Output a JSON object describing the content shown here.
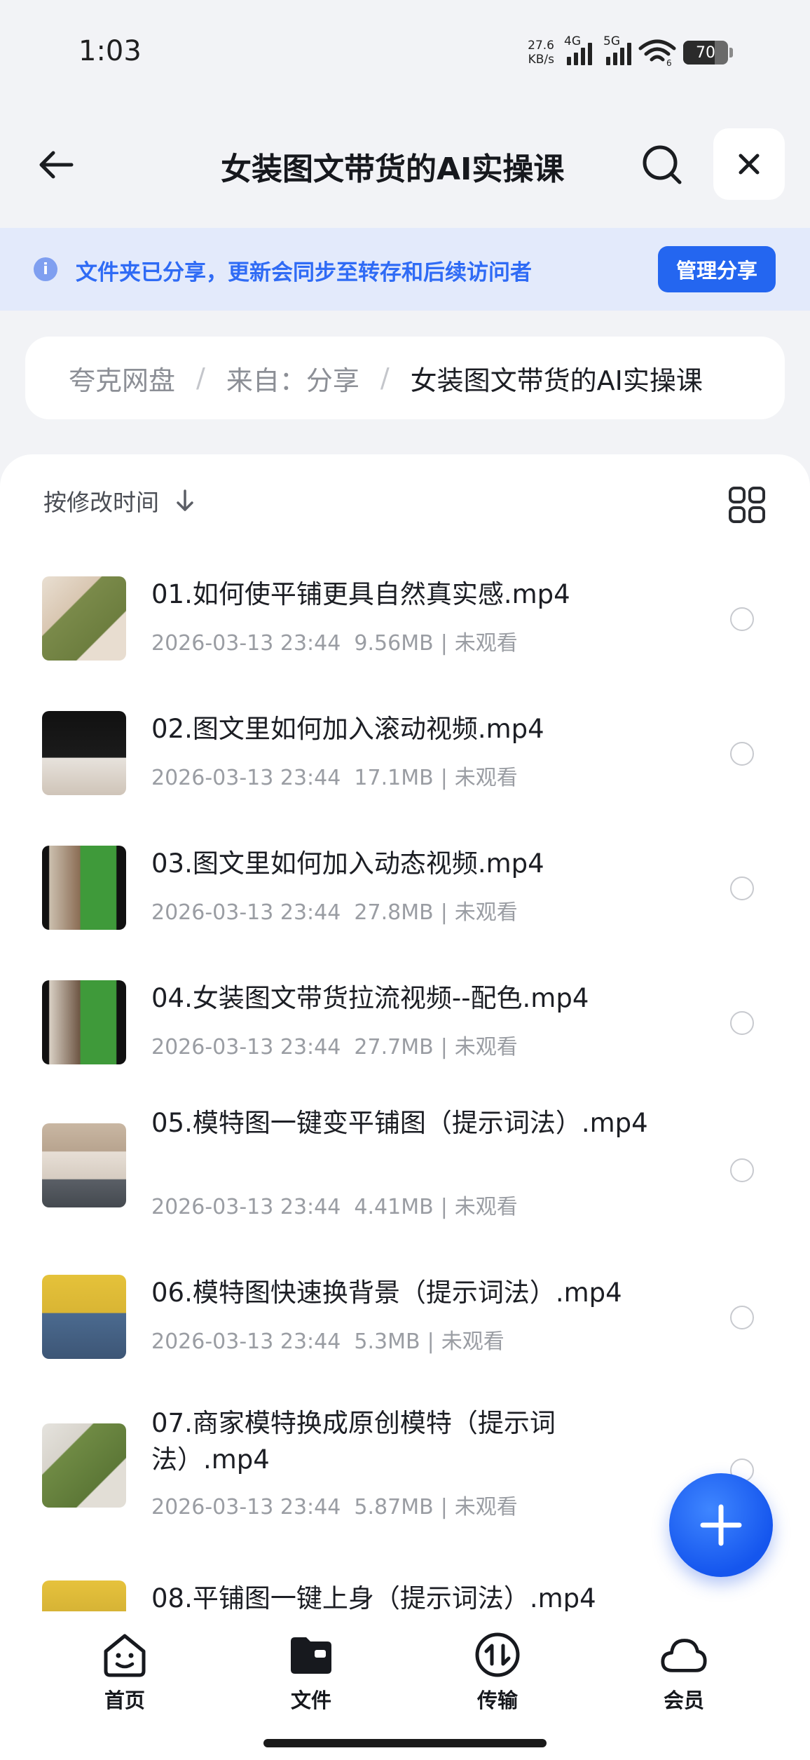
{
  "status_bar": {
    "time": "1:03",
    "net_speed_value": "27.6",
    "net_speed_unit": "KB/s",
    "sim1_label": "4G",
    "sim2_label": "5G",
    "wifi_label": "6",
    "battery": "70",
    "battery_level": 0.7
  },
  "header": {
    "title": "女装图文带货的AI实操课",
    "back_icon": "arrow-left-icon",
    "search_icon": "search-icon",
    "close_icon": "close-icon"
  },
  "share_banner": {
    "text": "文件夹已分享，更新会同步至转存和后续访问者",
    "button": "管理分享",
    "icon": "info-icon"
  },
  "breadcrumb": {
    "items": [
      "夸克网盘",
      "来自：分享",
      "女装图文带货的AI实操课"
    ],
    "separator": "/"
  },
  "list": {
    "sort_label": "按修改时间",
    "sort_icon": "arrow-down-icon",
    "view_icon": "grid-view-icon",
    "files": [
      {
        "name": "01.如何使平铺更具自然真实感.mp4",
        "date": "2026-03-13 23:44",
        "size": "9.56MB",
        "status": "未观看"
      },
      {
        "name": "02.图文里如何加入滚动视频.mp4",
        "date": "2026-03-13 23:44",
        "size": "17.1MB",
        "status": "未观看"
      },
      {
        "name": "03.图文里如何加入动态视频.mp4",
        "date": "2026-03-13 23:44",
        "size": "27.8MB",
        "status": "未观看"
      },
      {
        "name": "04.女装图文带货拉流视频--配色.mp4",
        "date": "2026-03-13 23:44",
        "size": "27.7MB",
        "status": "未观看"
      },
      {
        "name": "05.模特图一键变平铺图（提示词法）.mp4",
        "date": "2026-03-13 23:44",
        "size": "4.41MB",
        "status": "未观看"
      },
      {
        "name": "06.模特图快速换背景（提示词法）.mp4",
        "date": "2026-03-13 23:44",
        "size": "5.3MB",
        "status": "未观看"
      },
      {
        "name": "07.商家模特换成原创模特（提示词法）.mp4",
        "date": "2026-03-13 23:44",
        "size": "5.87MB",
        "status": "未观看"
      },
      {
        "name": "08.平铺图一键上身（提示词法）.mp4",
        "date": "",
        "size": "",
        "status": ""
      }
    ]
  },
  "fab": {
    "icon": "plus-icon"
  },
  "bottom_nav": {
    "items": [
      {
        "label": "首页",
        "icon": "home-face-icon"
      },
      {
        "label": "文件",
        "icon": "folder-icon"
      },
      {
        "label": "传输",
        "icon": "transfer-icon"
      },
      {
        "label": "会员",
        "icon": "cloud-icon"
      }
    ]
  },
  "colors": {
    "accent": "#2466f0",
    "banner_bg": "#e3eafb",
    "banner_text": "#2f6bf5",
    "page_bg": "#f2f3f6"
  }
}
